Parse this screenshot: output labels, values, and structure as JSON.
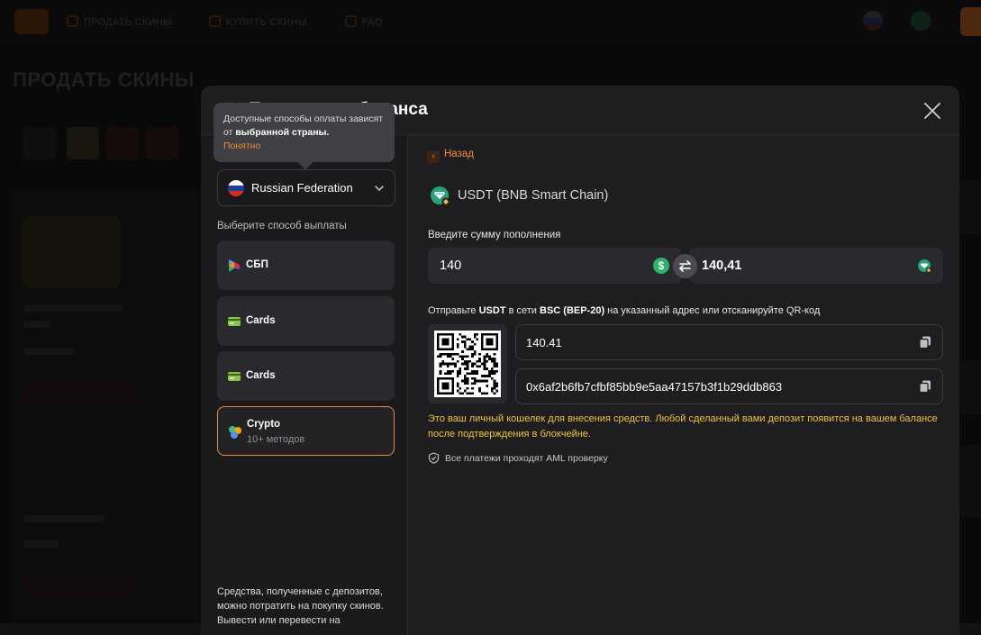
{
  "modal": {
    "title": "Пополнение баланса"
  },
  "tooltip": {
    "text_start": "Доступные способы оплаты зависят от ",
    "text_bold": "выбранной страны.",
    "ok_label": "Понятно"
  },
  "country": {
    "selected": "Russian Federation",
    "flag_colors": [
      "#ffffff",
      "#1c3f9e",
      "#d52b1e"
    ]
  },
  "methods": {
    "label": "Выберите способ выплаты",
    "items": [
      {
        "label": "СБП",
        "sub": ""
      },
      {
        "label": "Cards",
        "sub": ""
      },
      {
        "label": "Cards",
        "sub": ""
      },
      {
        "label": "Crypto",
        "sub": "10+ методов"
      }
    ]
  },
  "left_footer": "Средства, полученные с депозитов, можно потратить на покупку скинов. Вывести или перевести на",
  "right": {
    "back_label": "Назад",
    "coin_name": "USDT (BNB Smart Chain)",
    "amount_label": "Введите сумму пополнения",
    "amount_input": "140",
    "amount_output": "140,41",
    "send_parts": {
      "p1": "Отправьте ",
      "coin": "USDT",
      "p2": " в сети ",
      "network": "BSC (BEP-20)",
      "p3": " на указанный адрес или отсканируйте QR-код"
    },
    "amount_field": "140.41",
    "address": "0x6af2b6fb7cfbf85bb9e5aa47157b3f1b29ddb863",
    "warning": "Это ваш личный кошелек для внесения средств. Любой сделанный вами депозит появится на вашем балансе после подтверждения в блокчейне.",
    "aml_note": "Все платежи проходят AML проверку"
  },
  "background": {
    "nav": [
      "ПРОДАТЬ СКИНЫ",
      "КУПИТЬ СКИНЫ",
      "FAQ"
    ],
    "page_title": "ПРОДАТЬ СКИНЫ"
  },
  "colors": {
    "accent": "#f28a33",
    "warning": "#f2c23a",
    "usdt": "#26a17b",
    "success": "#2db36a"
  }
}
